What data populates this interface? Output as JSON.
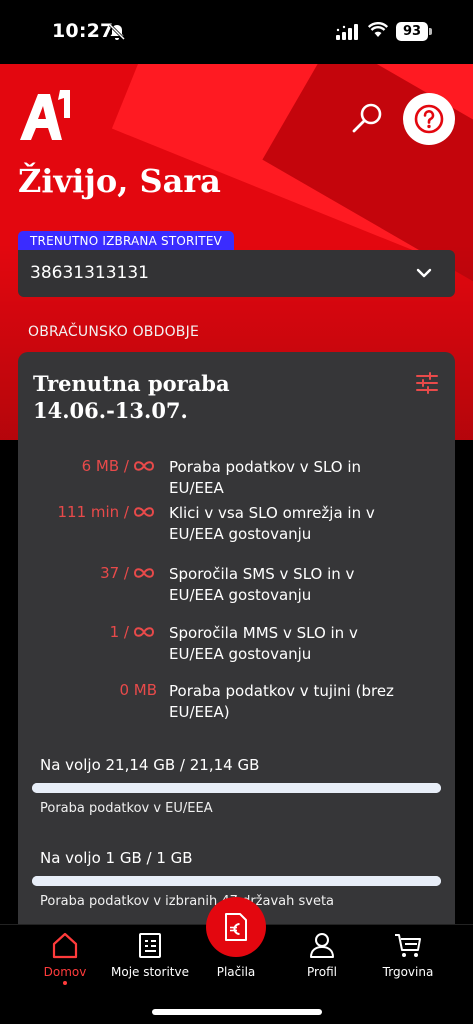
{
  "status": {
    "time": "10:27",
    "battery": "93"
  },
  "header": {
    "greeting": "Živijo, Sara",
    "service_tag": "TRENUTNO IZBRANA STORITEV",
    "service_number": "38631313131",
    "period_label": "OBRAČUNSKO OBDOBJE"
  },
  "card": {
    "title_line1": "Trenutna poraba",
    "title_line2": "14.06.-13.07.",
    "usage": [
      {
        "amount": "6 MB /",
        "desc": "Poraba podatkov v SLO in EU/EEA",
        "unlimited": true
      },
      {
        "amount": "111 min /",
        "desc": "Klici v vsa SLO omrežja in v EU/EEA gostovanju",
        "unlimited": true
      },
      {
        "amount": "37 /",
        "desc": "Sporočila SMS v SLO in v EU/EEA gostovanju",
        "unlimited": true
      },
      {
        "amount": "1 /",
        "desc": "Sporočila MMS v SLO in v EU/EEA gostovanju",
        "unlimited": true
      },
      {
        "amount": "0 MB",
        "desc": "Poraba podatkov v tujini (brez EU/EEA)",
        "unlimited": false
      }
    ],
    "allowances": [
      {
        "label": "Na voljo 21,14 GB / 21,14 GB",
        "caption": "Poraba podatkov v EU/EEA",
        "remaining_fraction": 1.0
      },
      {
        "label": "Na voljo 1 GB / 1 GB",
        "caption": "Poraba podatkov v izbranih 47 državah sveta",
        "remaining_fraction": 1.0
      }
    ]
  },
  "tabs": [
    {
      "label": "Domov",
      "icon": "home-icon",
      "active": true
    },
    {
      "label": "Moje storitve",
      "icon": "services-icon",
      "active": false
    },
    {
      "label": "Plačila",
      "icon": "euro-invoice-icon",
      "active": false
    },
    {
      "label": "Profil",
      "icon": "profile-icon",
      "active": false
    },
    {
      "label": "Trgovina",
      "icon": "cart-icon",
      "active": false
    }
  ],
  "colors": {
    "brand_red": "#e3070f",
    "tag_blue": "#3a2cff",
    "card_bg": "#363638",
    "usage_red": "#e84a4a"
  }
}
